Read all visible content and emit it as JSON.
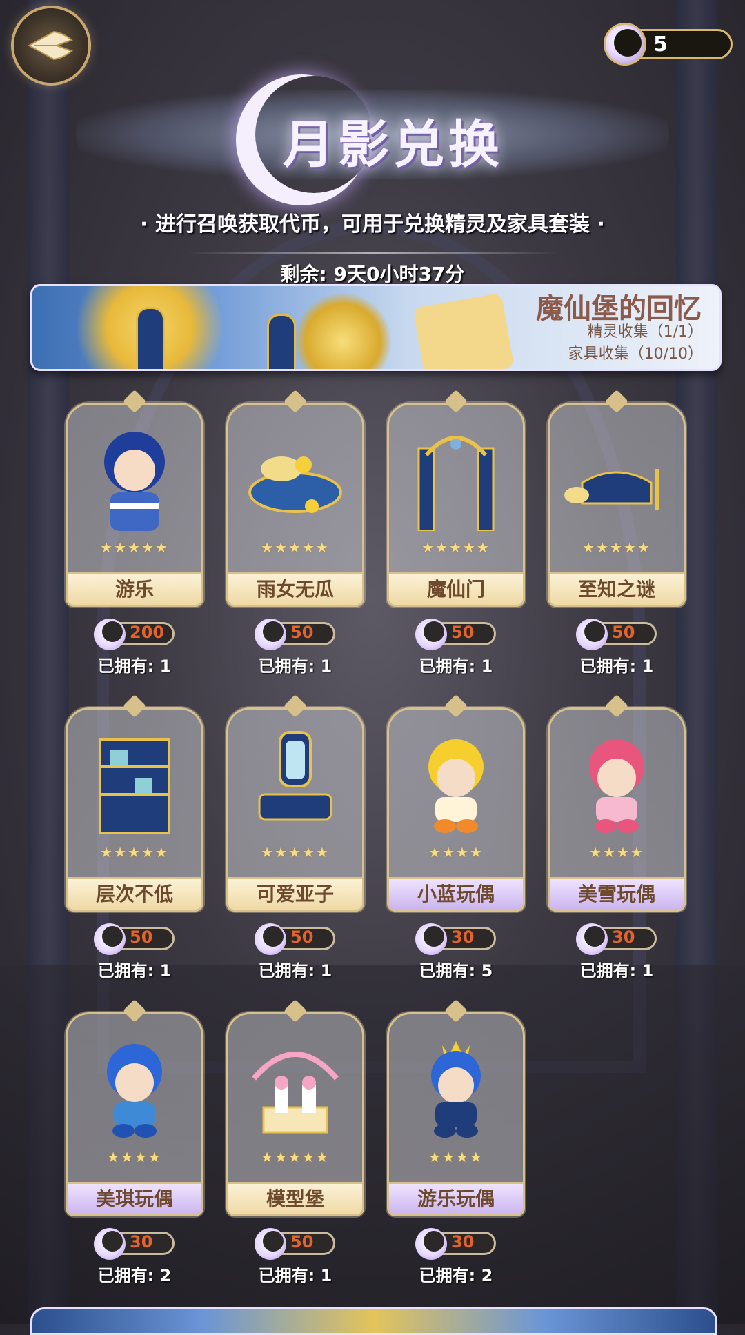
{
  "currency": {
    "amount": "5"
  },
  "header": {
    "title": "月影兑换",
    "subtitle": "· 进行召唤获取代币，可用于兑换精灵及家具套装 ·",
    "remaining": "剩余: 9天0小时37分"
  },
  "banner": {
    "title": "魔仙堡的回忆",
    "line1": "精灵收集（1/1）",
    "line2": "家具收集（10/10）"
  },
  "items": [
    {
      "name": "游乐",
      "price": "200",
      "owned": "已拥有: 1",
      "stars": "★★★★★",
      "label_style": "gold"
    },
    {
      "name": "雨女无瓜",
      "price": "50",
      "owned": "已拥有: 1",
      "stars": "★★★★★",
      "label_style": "gold"
    },
    {
      "name": "魔仙门",
      "price": "50",
      "owned": "已拥有: 1",
      "stars": "★★★★★",
      "label_style": "gold"
    },
    {
      "name": "至知之谜",
      "price": "50",
      "owned": "已拥有: 1",
      "stars": "★★★★★",
      "label_style": "gold"
    },
    {
      "name": "层次不低",
      "price": "50",
      "owned": "已拥有: 1",
      "stars": "★★★★★",
      "label_style": "gold"
    },
    {
      "name": "可爱亚子",
      "price": "50",
      "owned": "已拥有: 1",
      "stars": "★★★★★",
      "label_style": "gold"
    },
    {
      "name": "小蓝玩偶",
      "price": "30",
      "owned": "已拥有: 5",
      "stars": "★★★★",
      "label_style": "purple"
    },
    {
      "name": "美雪玩偶",
      "price": "30",
      "owned": "已拥有: 1",
      "stars": "★★★★",
      "label_style": "purple"
    },
    {
      "name": "美琪玩偶",
      "price": "30",
      "owned": "已拥有: 2",
      "stars": "★★★★",
      "label_style": "purple"
    },
    {
      "name": "模型堡",
      "price": "50",
      "owned": "已拥有: 1",
      "stars": "★★★★★",
      "label_style": "gold"
    },
    {
      "name": "游乐玩偶",
      "price": "30",
      "owned": "已拥有: 2",
      "stars": "★★★★",
      "label_style": "purple"
    }
  ],
  "colors": {
    "gold": "#d7c08a",
    "price": "#e3632d",
    "label_text": "#6d4a2e"
  }
}
